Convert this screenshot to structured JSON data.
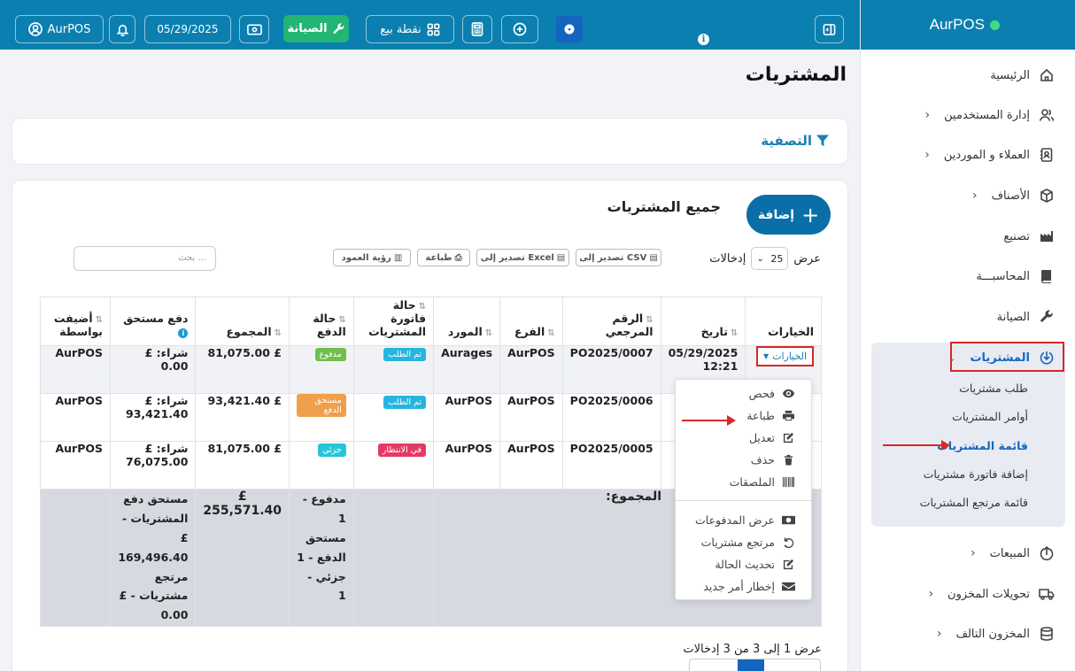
{
  "app": {
    "brand": "AurPOS"
  },
  "topbar": {
    "user": "AurPOS",
    "date": "05/29/2025",
    "maintenance": "الصيانة",
    "pos": "نقطة بيع"
  },
  "page": {
    "title": "المشتريات",
    "filter_label": "التصفية"
  },
  "sidebar": {
    "items": [
      {
        "label": "الرئيسية",
        "icon": "home-icon",
        "chevron": false
      },
      {
        "label": "إدارة المستخدمين",
        "icon": "users-icon",
        "chevron": true
      },
      {
        "label": "العملاء و الموردين",
        "icon": "address-book-icon",
        "chevron": true
      },
      {
        "label": "الأصناف",
        "icon": "box-icon",
        "chevron": true
      },
      {
        "label": "تصنيع",
        "icon": "factory-icon",
        "chevron": false
      },
      {
        "label": "المحاسبـــة",
        "icon": "book-icon",
        "chevron": false
      },
      {
        "label": "الصيانة",
        "icon": "wrench-icon",
        "chevron": false
      },
      {
        "label": "المشتريات",
        "icon": "download-circle-icon",
        "chevron": true,
        "active": true
      },
      {
        "label": "المبيعات",
        "icon": "upload-circle-icon",
        "chevron": true
      },
      {
        "label": "تحويلات المخزون",
        "icon": "truck-icon",
        "chevron": true
      },
      {
        "label": "المخزون التالف",
        "icon": "database-icon",
        "chevron": true
      }
    ],
    "submenu": [
      {
        "label": "طلب مشتريات"
      },
      {
        "label": "أوامر المشتريات"
      },
      {
        "label": "قائمة المشتريات",
        "active": true
      },
      {
        "label": "إضافة فاتورة مشتريات"
      },
      {
        "label": "قائمة مرتجع المشتريات"
      }
    ]
  },
  "list": {
    "title": "جميع المشتريات",
    "add_button": "إضافة",
    "show_label": "عرض",
    "entries_label": "إدخالات",
    "page_length": "25",
    "search_placeholder": "بحث ...",
    "export_buttons": [
      "تصدير إلى CSV",
      "تصدير إلى Excel",
      "طباعة",
      "رؤية العمود"
    ]
  },
  "table": {
    "headers": [
      "الخيارات",
      "تاريخ",
      "الرقم المرجعي",
      "الفرع",
      "المورد",
      "حالة فاتورة المشتريات",
      "حالة الدفع",
      "المجموع",
      "دفع مستحق",
      "أضيفت بواسطة"
    ],
    "options_label": "الخيارات",
    "rows": [
      {
        "date": "05/29/2025 12:21",
        "ref": "PO2025/0007",
        "branch": "AurPOS",
        "supplier": "Aurages",
        "status": "تم الطلب",
        "payment": "مدفوع",
        "payment_color": "#6fbf4a",
        "total": "£ 81,075.00",
        "due": "شراء: £ 0.00",
        "added_by": "AurPOS"
      },
      {
        "date": "",
        "ref": "PO2025/0006",
        "branch": "AurPOS",
        "supplier": "AurPOS",
        "status": "تم الطلب",
        "payment": "مستحق الدفع",
        "payment_color": "#f0a04b",
        "total": "£ 93,421.40",
        "due": "شراء: £ 93,421.40",
        "added_by": "AurPOS"
      },
      {
        "date": "",
        "ref": "PO2025/0005",
        "branch": "AurPOS",
        "supplier": "AurPOS",
        "status": "في الانتظار",
        "payment": "جزئي",
        "payment_color": "#26c6da",
        "total": "£ 81,075.00",
        "due": "شراء: £ 76,075.00",
        "added_by": "AurPOS"
      }
    ],
    "status_colors": {
      "تم الطلب": "#26b5e0",
      "في الانتظار": "#e53965"
    },
    "footer": {
      "label": "المجموع:",
      "payment_summary": "مدفوع - 1 مستحق الدفع - 1 جزئي - 1",
      "total": "£ 255,571.40",
      "due_summary": "مستحق دفع المشتريات - £ 169,496.40 مرتجع مشتريات - £ 0.00"
    }
  },
  "dropdown": {
    "items": [
      {
        "label": "فحص",
        "icon": "eye-icon"
      },
      {
        "label": "طباعة",
        "icon": "print-icon"
      },
      {
        "label": "تعديل",
        "icon": "edit-icon"
      },
      {
        "label": "حذف",
        "icon": "trash-icon"
      },
      {
        "label": "الملصقات",
        "icon": "barcode-icon"
      },
      {
        "label": "عرض المدفوعات",
        "icon": "money-icon"
      },
      {
        "label": "مرتجع مشتريات",
        "icon": "undo-icon"
      },
      {
        "label": "تحديث الحالة",
        "icon": "edit-icon"
      },
      {
        "label": "إخطار أمر جديد",
        "icon": "envelope-icon"
      }
    ]
  },
  "pagination": {
    "info": "عرض 1 إلى 3 من 3 إدخالات"
  }
}
